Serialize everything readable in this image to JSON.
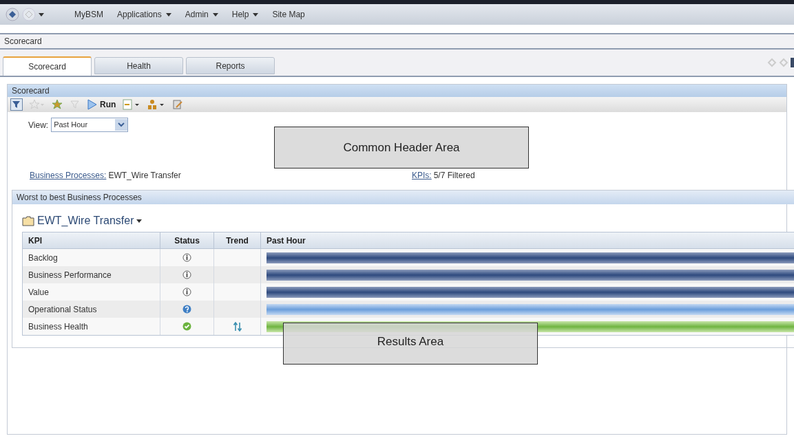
{
  "nav": {
    "menus": [
      {
        "label": "MyBSM",
        "dropdown": false
      },
      {
        "label": "Applications",
        "dropdown": true
      },
      {
        "label": "Admin",
        "dropdown": true
      },
      {
        "label": "Help",
        "dropdown": true
      },
      {
        "label": "Site Map",
        "dropdown": false
      }
    ]
  },
  "breadcrumb": "Scorecard",
  "tabs": [
    {
      "label": "Scorecard",
      "selected": true
    },
    {
      "label": "Health",
      "selected": false
    },
    {
      "label": "Reports",
      "selected": false
    }
  ],
  "scorecard_panel": {
    "title": "Scorecard",
    "run_label": "Run",
    "view_label": "View:",
    "view_value": "Past Hour",
    "bp_link": "Business Processes:",
    "bp_value": "EWT_Wire Transfer",
    "kpi_link": "KPIs:",
    "kpi_value": "5/7 Filtered"
  },
  "callouts": [
    {
      "text": "Common Header Area"
    },
    {
      "text": "Results Area"
    }
  ],
  "results_panel": {
    "title": "Worst to best Business Processes",
    "process": "EWT_Wire Transfer",
    "table": {
      "columns": [
        "KPI",
        "Status",
        "Trend",
        "Past Hour"
      ],
      "rows": [
        {
          "kpi": "Backlog",
          "kind": "info",
          "trend_arrows": false
        },
        {
          "kpi": "Business Performance",
          "kind": "info",
          "trend_arrows": false
        },
        {
          "kpi": "Value",
          "kind": "info",
          "trend_arrows": false
        },
        {
          "kpi": "Operational Status",
          "kind": "unknown",
          "trend_arrows": false
        },
        {
          "kpi": "Business Health",
          "kind": "ok",
          "trend_arrows": true
        }
      ]
    }
  }
}
